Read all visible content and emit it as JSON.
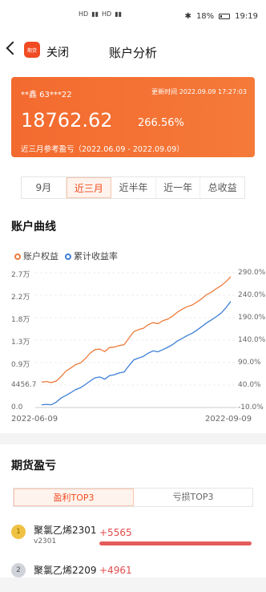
{
  "status": {
    "icons": [
      "HD",
      "HD"
    ],
    "battery_pct": "18%",
    "time": "19:19"
  },
  "nav": {
    "app_icon_text": "期货",
    "close_label": "关闭",
    "title": "账户分析"
  },
  "card": {
    "account": "**鑫 63***22",
    "update_time": "更新时间 2022.09.09 17:27:03",
    "value": "18762.62",
    "return_pct": "266.56%",
    "range_text": "近三月参考盈亏（2022.06.09 - 2022.09.09）"
  },
  "period_tabs": [
    {
      "label": "9月",
      "active": false
    },
    {
      "label": "近三月",
      "active": true
    },
    {
      "label": "近半年",
      "active": false
    },
    {
      "label": "近一年",
      "active": false
    },
    {
      "label": "总收益",
      "active": false
    }
  ],
  "curve": {
    "title": "账户曲线",
    "legend": [
      "账户权益",
      "累计收益率"
    ],
    "colors": {
      "equity": "#ee7b3c",
      "ret": "#3d7fd6"
    },
    "y_left": [
      "2.7万",
      "2.2万",
      "1.8万",
      "1.3万",
      "0.9万",
      "4456.7",
      "0.0"
    ],
    "y_right": [
      "290.0%",
      "240.0%",
      "190.0%",
      "140.0%",
      "90.0%",
      "40.0%",
      "-10.0%"
    ],
    "x_start": "2022-06-09",
    "x_end": "2022-09-09"
  },
  "chart_data": {
    "type": "line",
    "xlabel": "",
    "ylabel": "",
    "x_range": [
      "2022-06-09",
      "2022-09-09"
    ],
    "ylim_left": [
      0,
      27000
    ],
    "ylim_right": [
      -10,
      290
    ],
    "series": [
      {
        "name": "账户权益",
        "axis": "left",
        "values": [
          5100,
          5200,
          5000,
          5300,
          6200,
          7300,
          7900,
          8600,
          8900,
          9800,
          10900,
          11600,
          11700,
          11200,
          12000,
          12100,
          12400,
          12600,
          13900,
          15200,
          15600,
          15900,
          16600,
          17000,
          16800,
          17400,
          17700,
          18300,
          19100,
          19700,
          20200,
          20500,
          21100,
          21800,
          22600,
          23100,
          23800,
          24400,
          25200,
          26200
        ]
      },
      {
        "name": "累计收益率",
        "axis": "right",
        "values": [
          -4,
          -3,
          -4,
          2,
          11,
          17,
          23,
          30,
          34,
          41,
          49,
          56,
          58,
          53,
          61,
          63,
          67,
          69,
          83,
          96,
          100,
          104,
          111,
          116,
          114,
          119,
          124,
          130,
          138,
          144,
          150,
          155,
          162,
          170,
          178,
          185,
          192,
          200,
          212,
          226
        ]
      }
    ]
  },
  "futures": {
    "title": "期货盈亏",
    "tabs": [
      {
        "label": "盈利TOP3",
        "active": true
      },
      {
        "label": "亏损TOP3",
        "active": false
      }
    ],
    "rows": [
      {
        "rank": "1",
        "name": "聚氯乙烯2301",
        "code": "v2301",
        "value": "+5565",
        "bar_fraction": 1.0
      },
      {
        "rank": "2",
        "name": "聚氯乙烯2209",
        "code": "",
        "value": "+4961",
        "bar_fraction": 0.89
      }
    ]
  }
}
